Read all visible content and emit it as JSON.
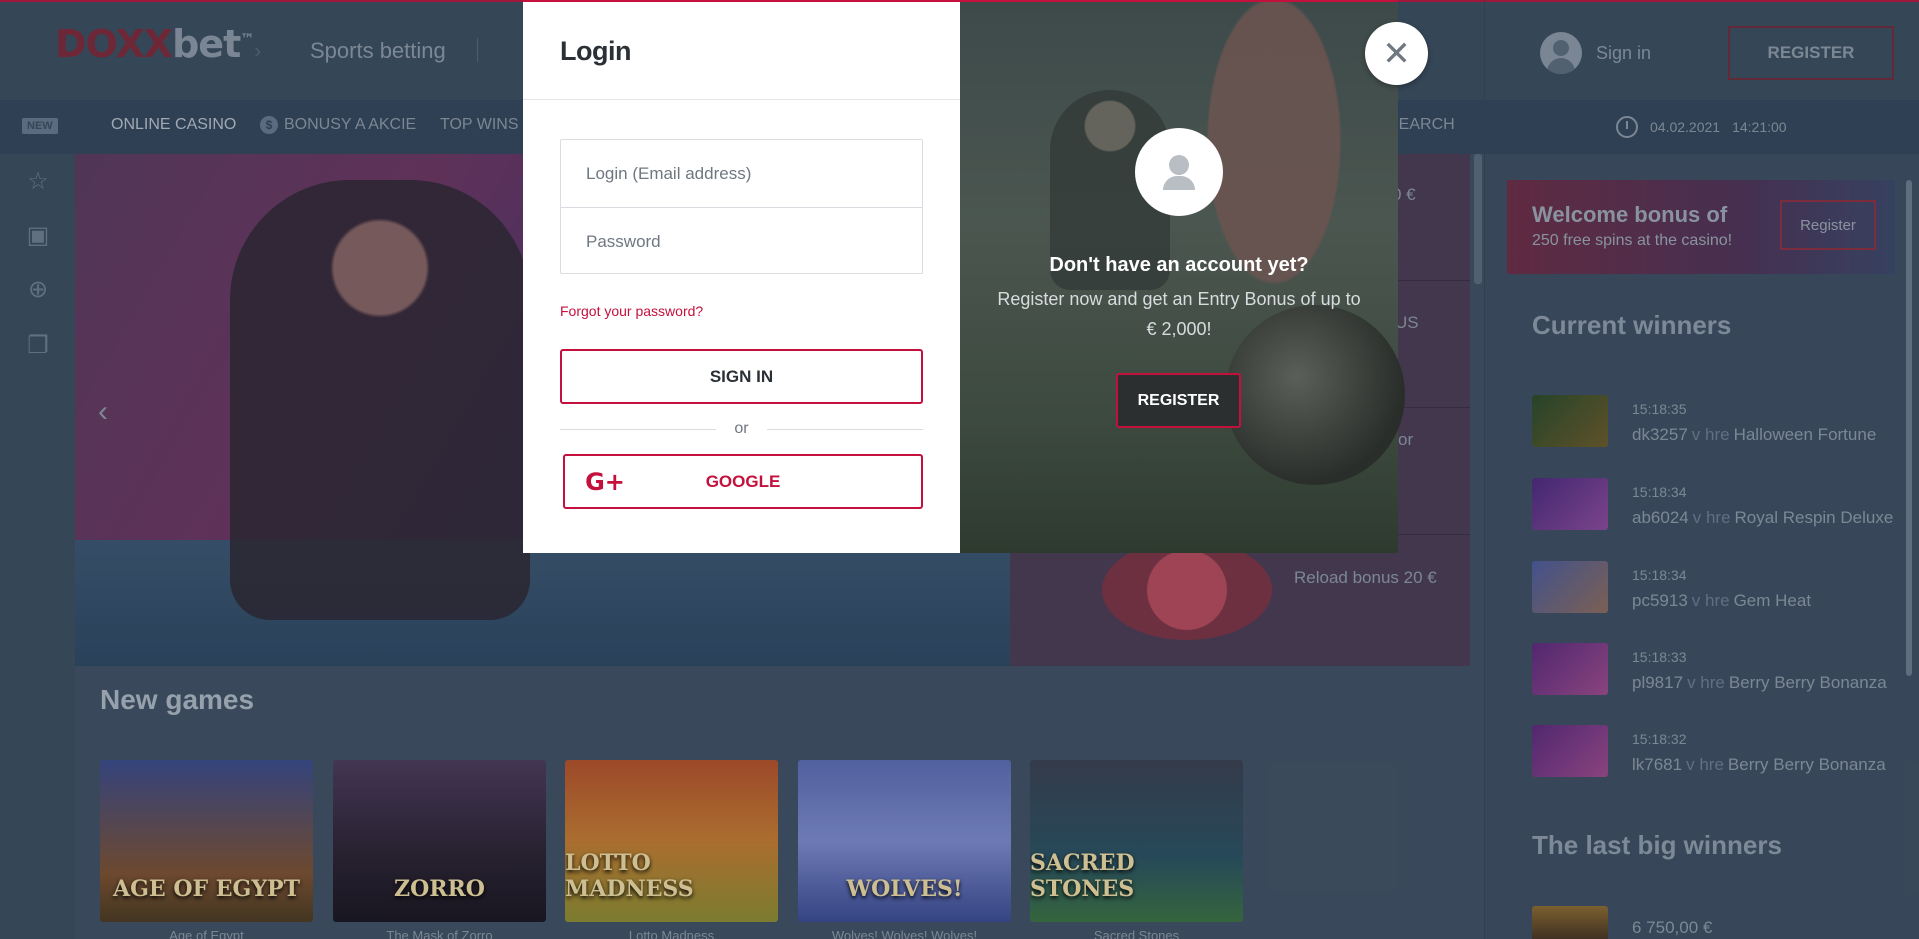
{
  "header": {
    "logo_part1": "DOXX",
    "logo_part2": "bet",
    "logo_tm": "™",
    "sports_betting": "Sports betting",
    "sign_in": "Sign in",
    "register": "REGISTER"
  },
  "subnav": {
    "new_badge": "NEW",
    "online_casino": "ONLINE CASINO",
    "bonusy": "BONUSY A AKCIE",
    "top_wins": "TOP WINS",
    "search": "SEARCH",
    "date": "04.02.2021",
    "time": "14:21:00"
  },
  "promos": {
    "row1_amount": "0 €",
    "row2_text": "US",
    "row3_text": "or",
    "reload": "Reload bonus 20 €"
  },
  "new_games": {
    "title": "New games",
    "games": [
      {
        "art": "AGE OF EGYPT",
        "caption": "Age of Egypt"
      },
      {
        "art": "ZORRO",
        "caption": "The Mask of Zorro"
      },
      {
        "art": "LOTTO MADNESS",
        "caption": "Lotto Madness"
      },
      {
        "art": "WOLVES!",
        "caption": "Wolves! Wolves! Wolves!"
      },
      {
        "art": "SACRED STONES",
        "caption": "Sacred Stones"
      }
    ]
  },
  "sidebar_right": {
    "welcome_title": "Welcome bonus of",
    "welcome_sub": "250 free spins at the casino!",
    "welcome_btn": "Register",
    "winners_title": "Current winners",
    "winners": [
      {
        "time": "15:18:35",
        "user": "dk3257",
        "in": "v hre",
        "game": "Halloween Fortune",
        "color": "#3a5a3a"
      },
      {
        "time": "15:18:34",
        "user": "ab6024",
        "in": "v hre",
        "game": "Royal Respin Deluxe",
        "color": "#6a3a8a"
      },
      {
        "time": "15:18:34",
        "user": "pc5913",
        "in": "v hre",
        "game": "Gem Heat",
        "color": "#6a5a8a"
      },
      {
        "time": "15:18:33",
        "user": "pl9817",
        "in": "v hre",
        "game": "Berry Berry Bonanza",
        "color": "#7a3a8a"
      },
      {
        "time": "15:18:32",
        "user": "lk7681",
        "in": "v hre",
        "game": "Berry Berry Bonanza",
        "color": "#7a3a8a"
      }
    ],
    "lastbig_title": "The last big winners",
    "lastbig_amount": "6 750,00 €"
  },
  "login_modal": {
    "title": "Login",
    "login_placeholder": "Login (Email address)",
    "password_placeholder": "Password",
    "forgot": "Forgot your password?",
    "sign_in": "SIGN IN",
    "or": "or",
    "google": "GOOGLE",
    "google_icon": "G+",
    "no_account": "Don't have an account yet?",
    "register_desc": "Register now and get an Entry Bonus of up to € 2,000!",
    "register": "REGISTER",
    "close": "✕"
  },
  "colors": {
    "accent": "#c4103c",
    "header_bg": "#3b4d5e"
  }
}
